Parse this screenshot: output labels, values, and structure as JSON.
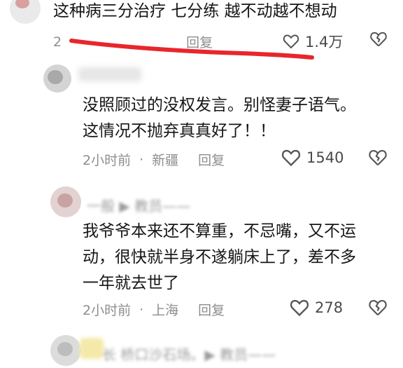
{
  "comments": [
    {
      "text_lines": [
        "这种病三分治疗 七分练  越不动越不想动"
      ],
      "meta_time": "2",
      "meta_location": "",
      "meta_reply": "回复",
      "likes": "1.4万"
    },
    {
      "username": "",
      "text_lines": [
        "没照顾过的没权发言。别怪妻子语气。",
        "这情况不抛弃真真好了！！"
      ],
      "meta_time": "2小时前",
      "meta_location": "新疆",
      "meta_reply": "回复",
      "likes": "1540"
    },
    {
      "username": "一般 ▶ 教员——",
      "text_lines": [
        "我爷爷本来还不算重，不忌嘴，又不运",
        "动，很快就半身不遂躺床上了，差不多",
        "一年就去世了"
      ],
      "meta_time": "2小时前",
      "meta_location": "上海",
      "meta_reply": "回复",
      "likes": "278"
    },
    {
      "username": "长       桥口沙石场。▶ 教员——"
    }
  ],
  "colors": {
    "annotation_red": "#e8262b",
    "meta_gray": "#8e8e8e"
  },
  "icons": [
    "heart-outline-icon",
    "broken-heart-icon"
  ]
}
